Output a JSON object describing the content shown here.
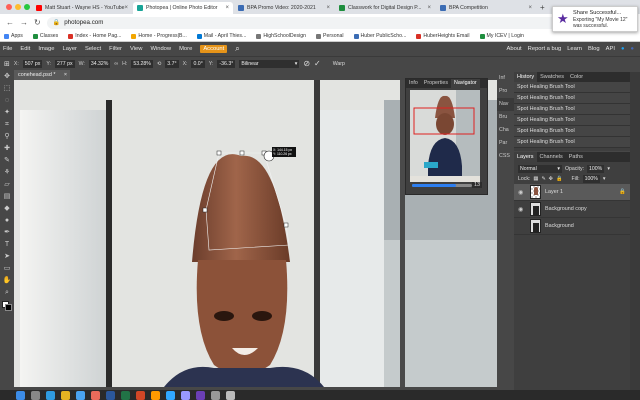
{
  "browser": {
    "tabs": [
      {
        "label": "Matt Stuart - Wayne HS - YouTube",
        "color": "#ff0000",
        "active": false
      },
      {
        "label": "Photopea | Online Photo Editor",
        "color": "#18a497",
        "active": true
      },
      {
        "label": "BPA Promo Video: 2020-2021",
        "color": "#3b6cb4",
        "active": false
      },
      {
        "label": "Classwork for Digital Design P...",
        "color": "#1e8e3e",
        "active": false
      },
      {
        "label": "BPA Competition",
        "color": "#3b6cb4",
        "active": false
      }
    ],
    "url": "photopea.com",
    "bookmarks": [
      {
        "label": "Apps",
        "color": "#4285f4"
      },
      {
        "label": "Classes",
        "color": "#1e8e3e"
      },
      {
        "label": "Index - Home Pag...",
        "color": "#d93025"
      },
      {
        "label": "Home - Progress|B...",
        "color": "#f2a600"
      },
      {
        "label": "Mail - April Thies...",
        "color": "#0078d4"
      },
      {
        "label": "HighSchoolDesign",
        "color": "#777777"
      },
      {
        "label": "Personal",
        "color": "#777777"
      },
      {
        "label": "Huber PublicScho...",
        "color": "#3b6cb4"
      },
      {
        "label": "HuberHeights Email",
        "color": "#d93025"
      },
      {
        "label": "My ICEV | Login",
        "color": "#1e8e3e"
      }
    ]
  },
  "notification": {
    "title": "Share Successful...",
    "body": "Exporting \"My Movie 12\" was successful."
  },
  "menu": {
    "items": [
      "File",
      "Edit",
      "Image",
      "Layer",
      "Select",
      "Filter",
      "View",
      "Window",
      "More"
    ],
    "account": "Account",
    "right": [
      "About",
      "Report a bug",
      "Learn",
      "Blog",
      "API"
    ]
  },
  "options": {
    "x_label": "X:",
    "x": "507 px",
    "y_label": "Y:",
    "y": "277 px",
    "w_label": "W:",
    "w": "34.32%",
    "h_label": "H:",
    "h": "53.28%",
    "angle": "3.7°",
    "hskew_label": "X:",
    "hskew": "0.0°",
    "vskew_label": "Y:",
    "vskew": "-36.3°",
    "interp": "Bilinear",
    "warp": "Warp"
  },
  "document": {
    "tab": "conehead.psd *"
  },
  "readout": {
    "line1": "X: 144.15 px",
    "line2": "Y: 110.26 px"
  },
  "info_panel": {
    "tabs": [
      "Info",
      "Properties",
      "Navigator"
    ],
    "zoom": "13"
  },
  "side_tabs": [
    "Inf",
    "Pro",
    "Nav",
    "Bru",
    "Cha",
    "Par",
    "CSS"
  ],
  "history": {
    "tabs": [
      "History",
      "Swatches",
      "Color"
    ],
    "items": [
      "Spot Healing Brush Tool",
      "Spot Healing Brush Tool",
      "Spot Healing Brush Tool",
      "Spot Healing Brush Tool",
      "Spot Healing Brush Tool",
      "Spot Healing Brush Tool"
    ]
  },
  "layers": {
    "tabs": [
      "Layers",
      "Channels",
      "Paths"
    ],
    "blend_mode": "Normal",
    "opacity_label": "Opacity:",
    "opacity": "100%",
    "lock_label": "Lock:",
    "fill_label": "Fill:",
    "fill": "100%",
    "items": [
      {
        "name": "Layer 1",
        "selected": true
      },
      {
        "name": "Background copy",
        "selected": false
      },
      {
        "name": "Background",
        "selected": false
      }
    ]
  },
  "colors": {
    "accent": "#e69419",
    "panel": "#3f3f3f",
    "app_bg": "#474747"
  }
}
